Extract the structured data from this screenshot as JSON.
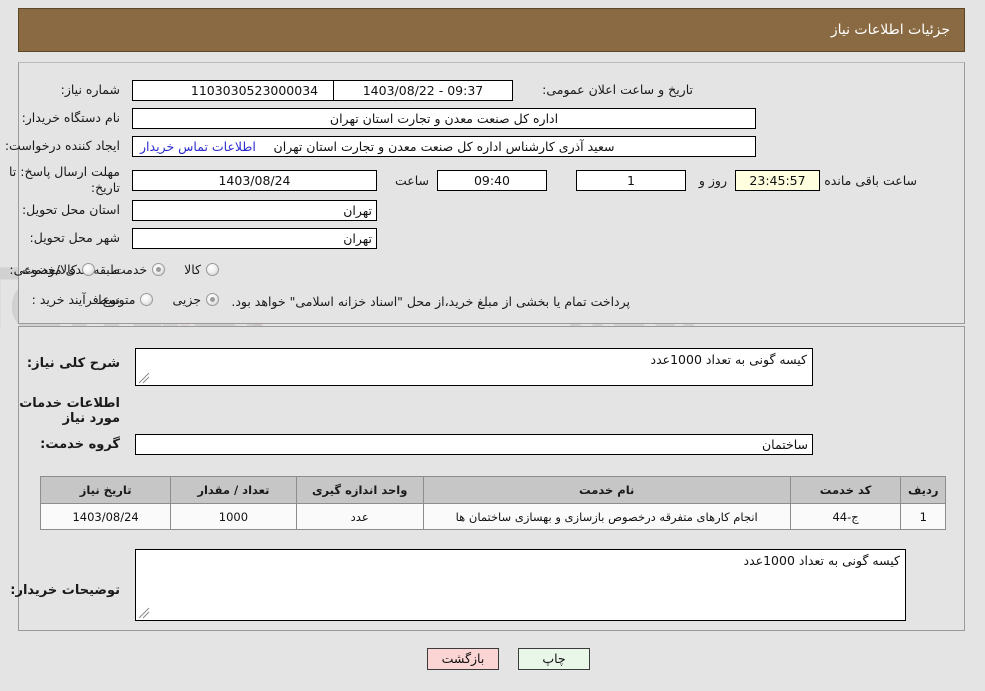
{
  "header": {
    "title": "جزئیات اطلاعات نیاز"
  },
  "watermark": {
    "text": "AriaTender.net"
  },
  "need_info": {
    "need_number_label": "شماره نیاز:",
    "need_number_value": "1103030523000034",
    "announce_label": "تاریخ و ساعت اعلان عمومی:",
    "announce_value": "09:37 - 1403/08/22",
    "buyer_org_label": "نام دستگاه خریدار:",
    "buyer_org_value": "اداره کل صنعت  معدن و تجارت استان تهران",
    "creator_label": "ایجاد کننده درخواست:",
    "creator_value": "سعید آذری کارشناس اداره کل صنعت  معدن و تجارت استان تهران",
    "contact_link": "اطلاعات تماس خریدار",
    "deadline_label": "مهلت ارسال پاسخ: تا تاریخ:",
    "deadline_date": "1403/08/24",
    "hour_label": "ساعت",
    "deadline_time": "09:40",
    "days_value": "1",
    "days_label": "روز و",
    "countdown_value": "23:45:57",
    "countdown_label": "ساعت باقی مانده",
    "province_label": "استان محل تحویل:",
    "province_value": "تهران",
    "city_label": "شهر محل تحویل:",
    "city_value": "تهران",
    "category_label": "طبقه بندی موضوعی:",
    "category_options": [
      "کالا",
      "خدمت",
      "کالا/خدمت"
    ],
    "category_selected": "خدمت",
    "process_label": "نوع فرآیند خرید :",
    "process_options": [
      "جزیی",
      "متوسط"
    ],
    "process_selected": "جزیی",
    "treasury_note": "پرداخت تمام یا بخشی از مبلغ خرید،از محل \"اسناد خزانه اسلامی\" خواهد بود."
  },
  "summary": {
    "general_label": "شرح کلی نیاز:",
    "general_value": "کیسه گونی به تعداد 1000عدد",
    "services_section_title": "اطلاعات خدمات مورد نیاز",
    "service_group_label": "گروه خدمت:",
    "service_group_value": "ساختمان"
  },
  "table": {
    "headers": [
      "ردیف",
      "کد خدمت",
      "نام خدمت",
      "واحد اندازه گیری",
      "تعداد / مقدار",
      "تاریخ نیاز"
    ],
    "rows": [
      {
        "radif": "1",
        "code": "ج-44",
        "name": "انجام کارهای متفرقه درخصوص بازسازی و بهسازی ساختمان ها",
        "unit": "عدد",
        "qty": "1000",
        "date": "1403/08/24"
      }
    ]
  },
  "buyer_notes": {
    "label": "توضیحات خریدار:",
    "value": "کیسه گونی به تعداد 1000عدد"
  },
  "buttons": {
    "print": "چاپ",
    "back": "بازگشت"
  },
  "colors": {
    "header_bg": "#8a6a42",
    "page_bg": "#e4e4e4",
    "link": "#2b2bd0",
    "countdown_bg": "#ffffe0",
    "print_btn_bg": "#e9f7e9",
    "back_btn_bg": "#fbd4d4",
    "table_header_bg": "#c6c6c6"
  }
}
